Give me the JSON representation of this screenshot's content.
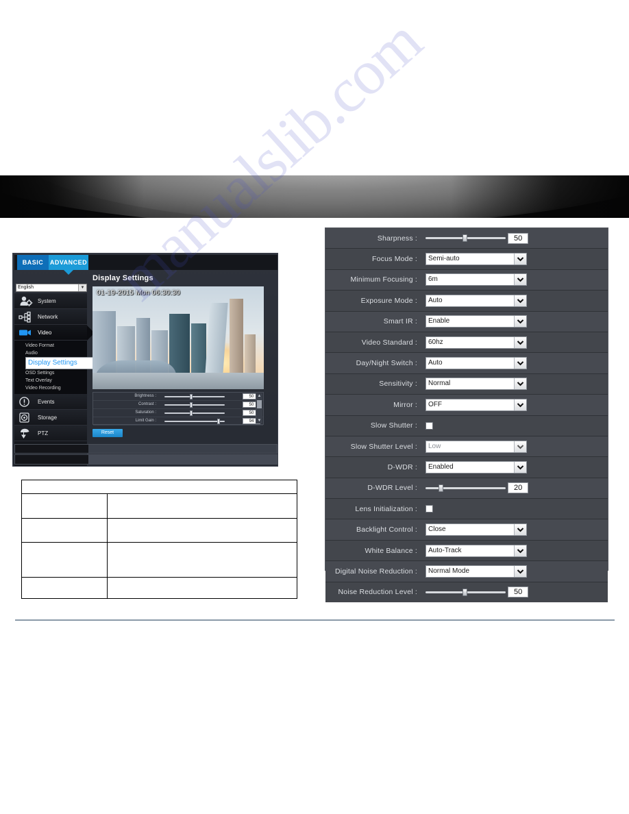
{
  "watermark": "manualslib.com",
  "camera_ui": {
    "tabs": {
      "basic": "BASIC",
      "advanced": "ADVANCED"
    },
    "language": "English",
    "nav": [
      {
        "label": "System",
        "icon": "system-user-gear-icon"
      },
      {
        "label": "Network",
        "icon": "network-nodes-icon"
      },
      {
        "label": "Video",
        "icon": "video-camera-icon"
      },
      {
        "label": "Events",
        "icon": "alert-exclamation-icon"
      },
      {
        "label": "Storage",
        "icon": "storage-disk-icon"
      },
      {
        "label": "PTZ",
        "icon": "ptz-dome-icon"
      }
    ],
    "video_submenu": [
      "Video Format",
      "Audio",
      "Display Settings",
      "OSD Settings",
      "Text Overlay",
      "Video Recording"
    ],
    "video_submenu_selected": "Display Settings",
    "content_title": "Display Settings",
    "preview_timestamp": "01-19-2015 Mon 06:30:30",
    "preview_sliders": [
      {
        "label": "Brightness :",
        "value": "50",
        "pct": 50
      },
      {
        "label": "Contrast :",
        "value": "50",
        "pct": 50
      },
      {
        "label": "Saturation :",
        "value": "50",
        "pct": 50
      },
      {
        "label": "Limit Gain :",
        "value": "94",
        "pct": 94
      }
    ],
    "reset_label": "Reset",
    "scroll_up": "▲",
    "scroll_down": "▼"
  },
  "settings_panel": {
    "rows": [
      {
        "label": "Sharpness :",
        "type": "slider",
        "value": "50",
        "pct": 50
      },
      {
        "label": "Focus Mode :",
        "type": "select",
        "value": "Semi-auto"
      },
      {
        "label": "Minimum Focusing :",
        "type": "select",
        "value": "6m"
      },
      {
        "label": "Exposure Mode :",
        "type": "select",
        "value": "Auto"
      },
      {
        "label": "Smart IR :",
        "type": "select",
        "value": "Enable"
      },
      {
        "label": "Video Standard :",
        "type": "select",
        "value": "60hz"
      },
      {
        "label": "Day/Night Switch :",
        "type": "select",
        "value": "Auto"
      },
      {
        "label": "Sensitivity :",
        "type": "select",
        "value": "Normal"
      },
      {
        "label": "Mirror :",
        "type": "select",
        "value": "OFF"
      },
      {
        "label": "Slow Shutter :",
        "type": "checkbox",
        "checked": false
      },
      {
        "label": "Slow Shutter Level :",
        "type": "select",
        "value": "Low",
        "disabled": true
      },
      {
        "label": "D-WDR :",
        "type": "select",
        "value": "Enabled"
      },
      {
        "label": "D-WDR Level :",
        "type": "slider",
        "value": "20",
        "pct": 20
      },
      {
        "label": "Lens Initialization :",
        "type": "checkbox",
        "checked": false
      },
      {
        "label": "Backlight Control :",
        "type": "select",
        "value": "Close"
      },
      {
        "label": "White Balance :",
        "type": "select",
        "value": "Auto-Track"
      },
      {
        "label": "Digital Noise Reduction :",
        "type": "select",
        "value": "Normal Mode"
      },
      {
        "label": "Noise Reduction Level :",
        "type": "slider",
        "value": "50",
        "pct": 50
      }
    ]
  },
  "spec_table": {
    "rows": [
      {
        "cells": [
          ""
        ],
        "span": 2
      },
      {
        "cells": [
          "",
          ""
        ]
      },
      {
        "cells": [
          "",
          ""
        ]
      },
      {
        "cells": [
          "",
          ""
        ]
      },
      {
        "cells": [
          "",
          ""
        ]
      }
    ]
  },
  "colors": {
    "tab_active": "#1b9bd8",
    "tab_inactive": "#0e6eb8",
    "submenu_selected": "#2196f3",
    "panel_bg": "#474a51",
    "reset_button": "#38a8e8"
  }
}
